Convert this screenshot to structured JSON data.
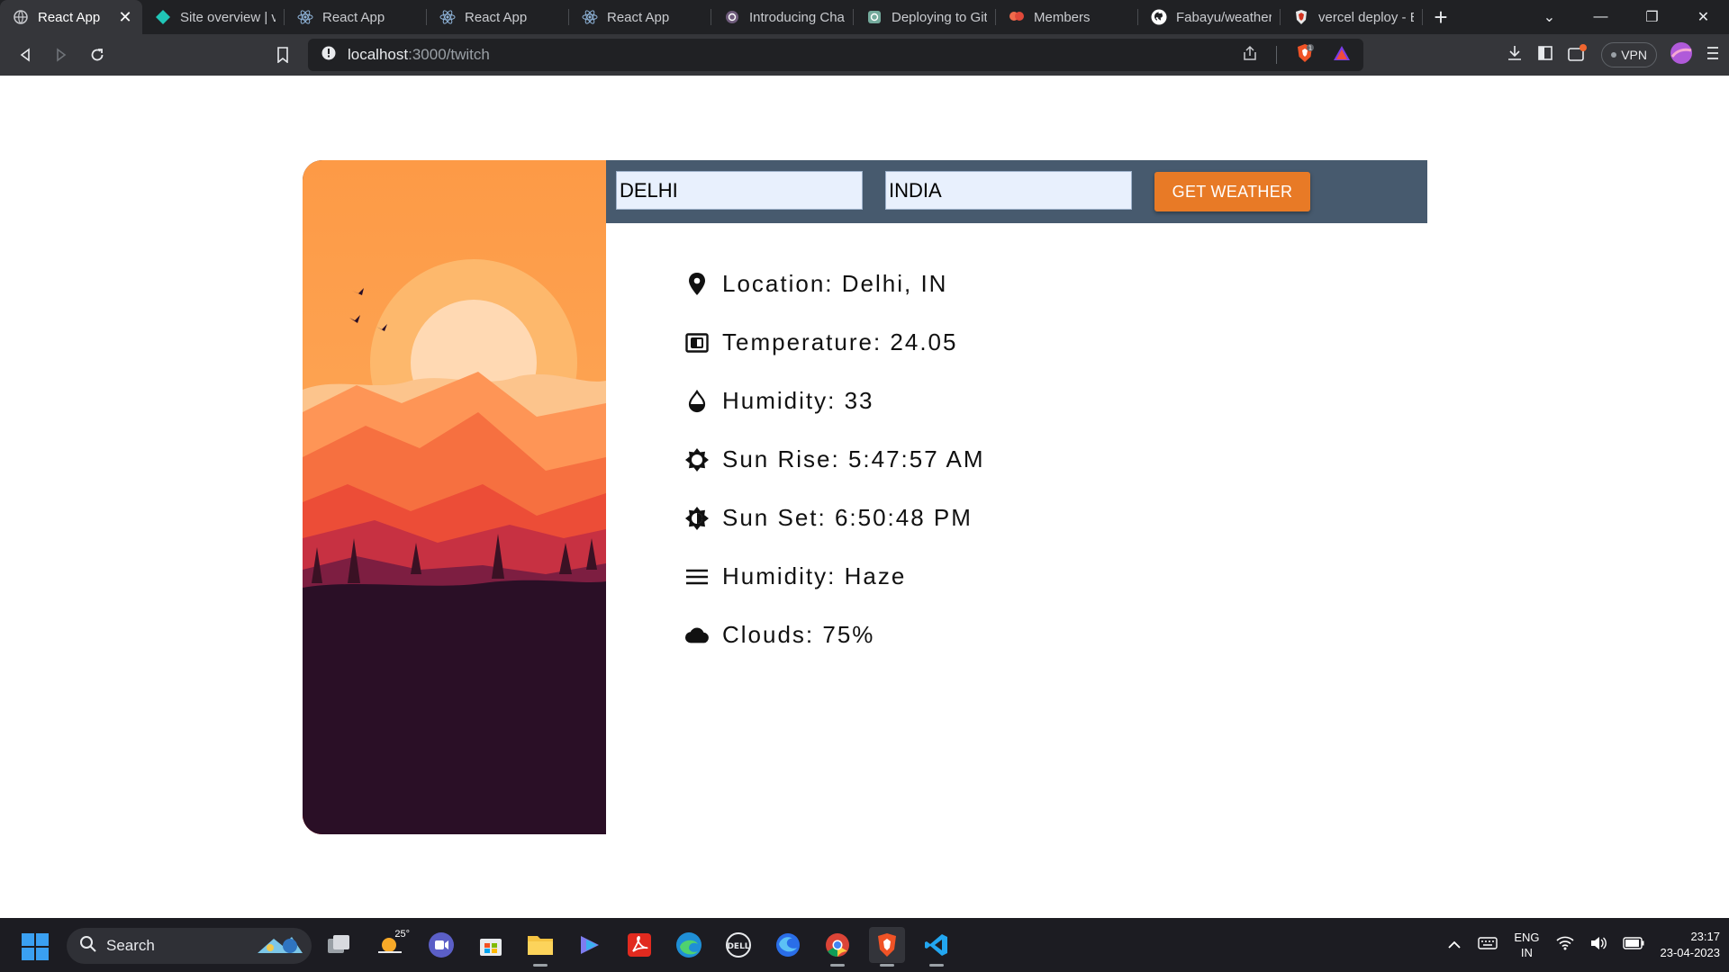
{
  "browser": {
    "tabs": [
      {
        "title": "React App",
        "icon": "react-icon",
        "active": true
      },
      {
        "title": "Site overview | ve",
        "icon": "netlify-icon",
        "active": false
      },
      {
        "title": "React App",
        "icon": "react-icon",
        "active": false
      },
      {
        "title": "React App",
        "icon": "react-icon",
        "active": false
      },
      {
        "title": "React App",
        "icon": "react-icon",
        "active": false
      },
      {
        "title": "Introducing Chat",
        "icon": "openai-icon",
        "active": false
      },
      {
        "title": "Deploying to Git",
        "icon": "openai-icon",
        "active": false
      },
      {
        "title": "Members",
        "icon": "members-icon",
        "active": false
      },
      {
        "title": "Fabayu/weather-",
        "icon": "github-icon",
        "active": false
      },
      {
        "title": "vercel deploy - B",
        "icon": "brave-icon",
        "active": false
      }
    ],
    "url_host": "localhost",
    "url_path": ":3000/twitch",
    "vpn_label": "VPN"
  },
  "form": {
    "city_value": "DELHI",
    "country_value": "INDIA",
    "button_label": "GET WEATHER"
  },
  "weather": {
    "rows": [
      {
        "label": "Location: Delhi, IN",
        "icon": "location-pin-icon"
      },
      {
        "label": "Temperature: 24.05",
        "icon": "thermometer-icon"
      },
      {
        "label": "Humidity: 33",
        "icon": "drop-icon"
      },
      {
        "label": "Sun Rise: 5:47:57 AM",
        "icon": "sunrise-icon"
      },
      {
        "label": "Sun Set: 6:50:48 PM",
        "icon": "sunset-icon"
      },
      {
        "label": "Humidity: Haze",
        "icon": "haze-icon"
      },
      {
        "label": "Clouds: 75%",
        "icon": "cloud-icon"
      }
    ]
  },
  "taskbar": {
    "search_label": "Search",
    "weather_temp": "25°",
    "lang_line1": "ENG",
    "lang_line2": "IN",
    "time": "23:17",
    "date": "23-04-2023"
  },
  "colors": {
    "form_bar": "#475a6e",
    "button": "#e87a26",
    "input_bg": "#e8f0fd"
  }
}
